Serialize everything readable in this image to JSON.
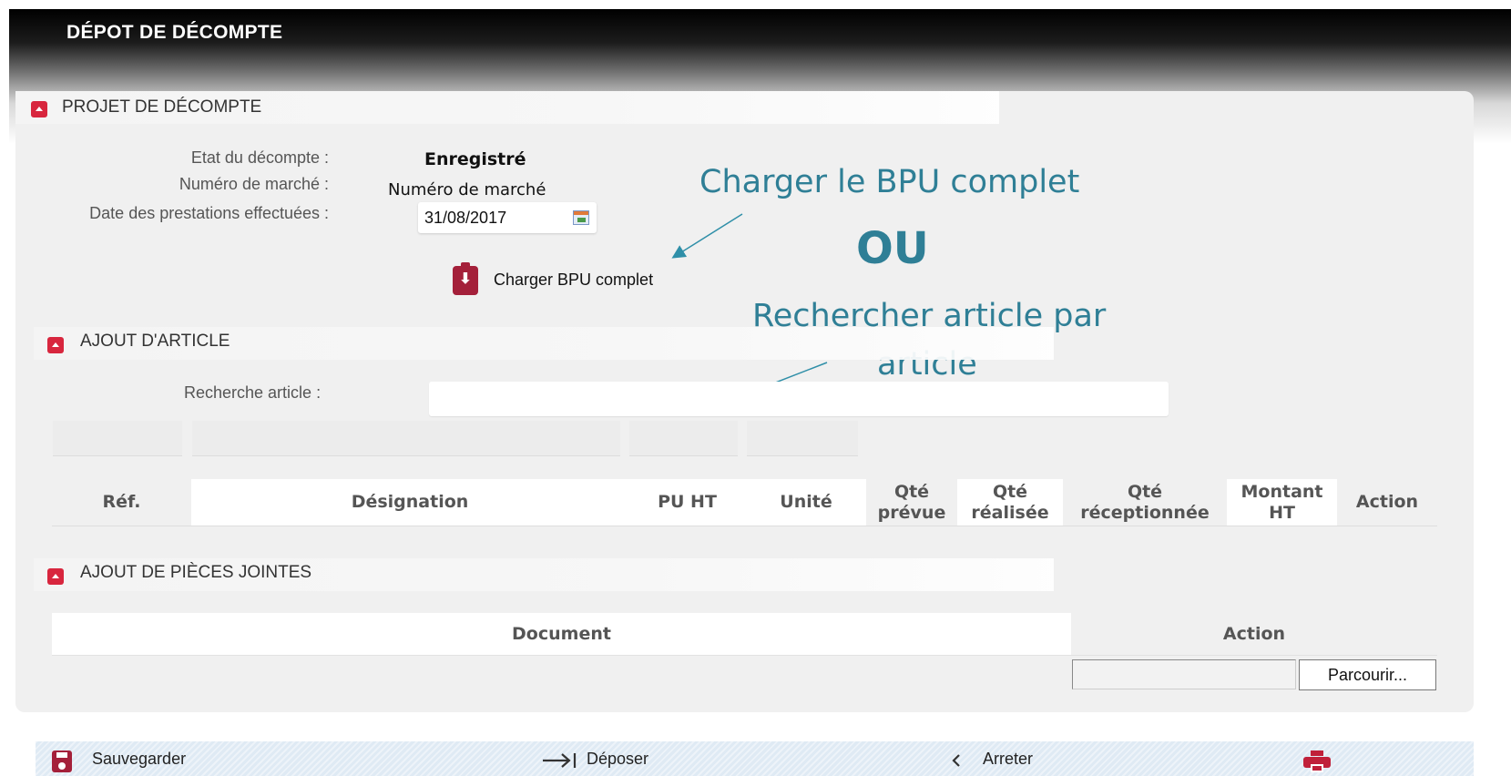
{
  "header": {
    "title": "DÉPOT DE DÉCOMPTE"
  },
  "projet": {
    "section_title": "PROJET DE DÉCOMPTE",
    "etat_label": "Etat du décompte :",
    "etat_value": "Enregistré",
    "numero_label": "Numéro de marché :",
    "numero_value": "Numéro de marché",
    "date_label": "Date des prestations effectuées :",
    "date_value": "31/08/2017",
    "bpu_button_label": "Charger BPU complet"
  },
  "annotations": {
    "charger": "Charger le BPU complet",
    "ou": "OU",
    "rechercher_line1": "Rechercher article par",
    "rechercher_line2": "article"
  },
  "ajout_article": {
    "section_title": "AJOUT D'ARTICLE",
    "search_label": "Recherche article :",
    "search_value": "",
    "columns": {
      "ref": "Réf.",
      "designation": "Désignation",
      "pu_ht": "PU HT",
      "unite": "Unité",
      "qte_prevue_1": "Qté",
      "qte_prevue_2": "prévue",
      "qte_realisee_1": "Qté",
      "qte_realisee_2": "réalisée",
      "qte_recep_1": "Qté",
      "qte_recep_2": "réceptionnée",
      "montant_1": "Montant",
      "montant_2": "HT",
      "action": "Action"
    }
  },
  "pieces_jointes": {
    "section_title": "AJOUT DE PIÈCES JOINTES",
    "col_document": "Document",
    "col_action": "Action",
    "browse_label": "Parcourir..."
  },
  "footer": {
    "save_label": "Sauvegarder",
    "deposer_label": "Déposer",
    "arreter_label": "Arreter"
  },
  "icons": {
    "collapse": "collapse-icon",
    "calendar": "calendar-icon",
    "bpu": "clipboard-download-icon",
    "save": "floppy-disk-icon",
    "deposer": "arrow-to-bar-icon",
    "arreter": "chevron-left-icon",
    "print": "printer-icon"
  },
  "colors": {
    "accent": "#a4203a",
    "annotation": "#2f7f96",
    "footer_bg": "#dfeaf4"
  }
}
